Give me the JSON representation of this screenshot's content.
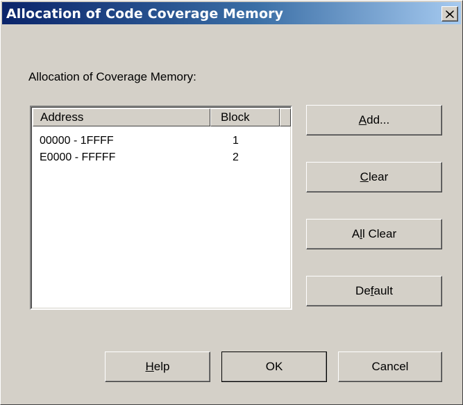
{
  "dialog": {
    "title": "Allocation of Code Coverage Memory",
    "section_label": "Allocation of Coverage Memory:"
  },
  "list": {
    "columns": [
      "Address",
      "Block"
    ],
    "rows": [
      {
        "address": "00000 - 1FFFF",
        "block": "1"
      },
      {
        "address": "E0000 - FFFFF",
        "block": "2"
      }
    ]
  },
  "buttons": {
    "add": {
      "pre": "",
      "key": "A",
      "post": "dd..."
    },
    "clear": {
      "pre": "",
      "key": "C",
      "post": "lear"
    },
    "all_clear": {
      "pre": "A",
      "key": "l",
      "post": "l Clear"
    },
    "default": {
      "pre": "De",
      "key": "f",
      "post": "ault"
    },
    "help": {
      "pre": "",
      "key": "H",
      "post": "elp"
    },
    "ok": "OK",
    "cancel": "Cancel"
  },
  "icons": {
    "close": "close-icon"
  }
}
